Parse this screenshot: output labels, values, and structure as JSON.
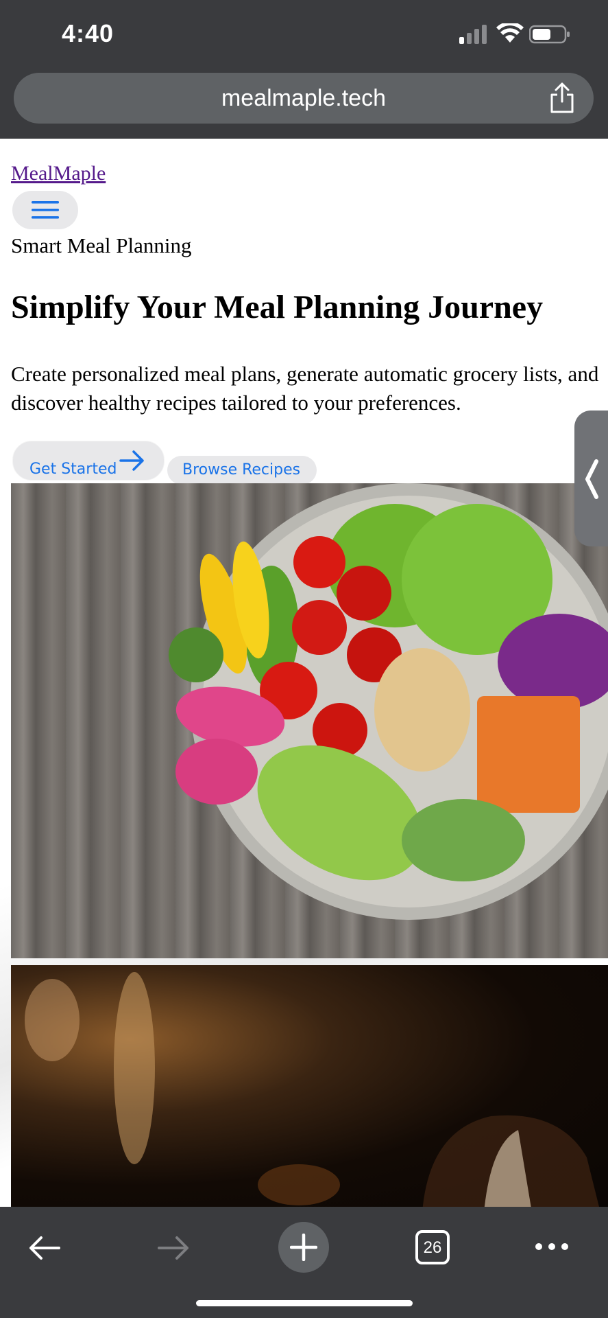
{
  "status_bar": {
    "time": "4:40",
    "icons": [
      "signal-icon",
      "wifi-icon",
      "battery-icon"
    ]
  },
  "browser": {
    "url": "mealmaple.tech",
    "share_icon": "share-icon",
    "tab_count": "26"
  },
  "site": {
    "brand": "MealMaple",
    "tagline": "Smart Meal Planning",
    "headline": "Simplify Your Meal Planning Journey",
    "description": "Create personalized meal plans, generate automatic grocery lists, and discover healthy recipes tailored to your preferences.",
    "primary_button": "Get Started",
    "secondary_button": "Browse Recipes"
  },
  "colors": {
    "link_blue": "#1a73e8",
    "visited_link": "#551a8b",
    "chrome_dark": "#3a3b3e"
  }
}
